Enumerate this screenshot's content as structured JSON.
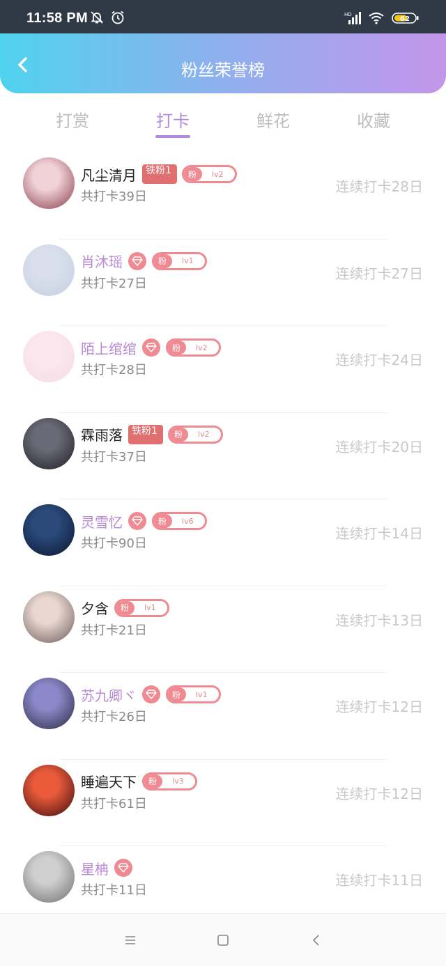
{
  "status_bar": {
    "time": "11:58 PM",
    "battery": "62",
    "network_badge": "HD",
    "icons": [
      "bell-off-icon",
      "alarm-icon",
      "signal-icon",
      "wifi-icon",
      "battery-icon"
    ]
  },
  "header": {
    "title": "粉丝荣誉榜",
    "back_icon": "chevron-left-icon"
  },
  "tabs": [
    {
      "label": "打赏",
      "active": false
    },
    {
      "label": "打卡",
      "active": true
    },
    {
      "label": "鲜花",
      "active": false
    },
    {
      "label": "收藏",
      "active": false
    }
  ],
  "colors": {
    "accent": "#b08cdc",
    "badge_pink": "#ef8a92",
    "iron_badge": "#e07070",
    "header_gradient": [
      "#4fd2ee",
      "#c396ea"
    ]
  },
  "rows": [
    {
      "name": "凡尘清月",
      "vip": false,
      "iron_badge": "铁粉1",
      "diamond": false,
      "fan_label": "粉",
      "fan_level": "lv2",
      "total": "共打卡39日",
      "streak": "连续打卡28日",
      "avatar_colors": [
        "#f0d3d8",
        "#8a3a4a"
      ]
    },
    {
      "name": "肖沐瑶",
      "vip": true,
      "iron_badge": "",
      "diamond": true,
      "fan_label": "粉",
      "fan_level": "lv1",
      "total": "共打卡27日",
      "streak": "连续打卡27日",
      "avatar_colors": [
        "#d9dfec",
        "#c7cfe0"
      ]
    },
    {
      "name": "陌上绾绾",
      "vip": true,
      "iron_badge": "",
      "diamond": true,
      "fan_label": "粉",
      "fan_level": "lv2",
      "total": "共打卡28日",
      "streak": "连续打卡24日",
      "avatar_colors": [
        "#fbe8ee",
        "#f6dbe3"
      ]
    },
    {
      "name": "霖雨落",
      "vip": false,
      "iron_badge": "铁粉1",
      "diamond": false,
      "fan_label": "粉",
      "fan_level": "lv2",
      "total": "共打卡37日",
      "streak": "连续打卡20日",
      "avatar_colors": [
        "#6a6a76",
        "#1d1d24"
      ]
    },
    {
      "name": "灵雪忆",
      "vip": true,
      "iron_badge": "",
      "diamond": true,
      "fan_label": "粉",
      "fan_level": "lv6",
      "total": "共打卡90日",
      "streak": "连续打卡14日",
      "avatar_colors": [
        "#2a4a7a",
        "#0a1530"
      ]
    },
    {
      "name": "夕含",
      "vip": false,
      "iron_badge": "",
      "diamond": false,
      "fan_label": "粉",
      "fan_level": "lv1",
      "total": "共打卡21日",
      "streak": "连续打卡13日",
      "avatar_colors": [
        "#e8d6cf",
        "#6a5a58"
      ]
    },
    {
      "name": "苏九卿ヾ",
      "vip": true,
      "iron_badge": "",
      "diamond": true,
      "fan_label": "粉",
      "fan_level": "lv1",
      "total": "共打卡26日",
      "streak": "连续打卡12日",
      "avatar_colors": [
        "#8a88c8",
        "#2a2840"
      ]
    },
    {
      "name": "睡遍天下",
      "vip": false,
      "iron_badge": "",
      "diamond": false,
      "fan_label": "粉",
      "fan_level": "lv3",
      "total": "共打卡61日",
      "streak": "连续打卡12日",
      "avatar_colors": [
        "#e85a3a",
        "#3a0a10"
      ]
    },
    {
      "name": "星柟",
      "vip": true,
      "iron_badge": "",
      "diamond": true,
      "fan_label": "",
      "fan_level": "",
      "total": "共打卡11日",
      "streak": "连续打卡11日",
      "avatar_colors": [
        "#cfcfcf",
        "#6e6e6e"
      ]
    }
  ],
  "nav_bar": [
    "menu-icon",
    "home-square-icon",
    "back-triangle-icon"
  ]
}
